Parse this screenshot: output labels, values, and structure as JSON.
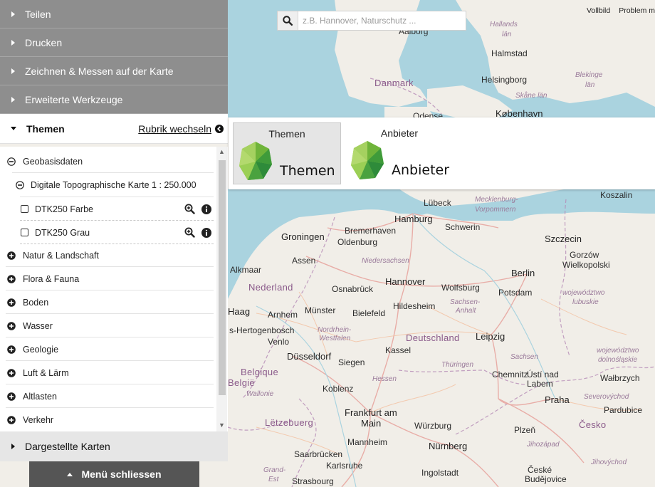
{
  "search": {
    "placeholder": "z.B. Hannover, Naturschutz ..."
  },
  "topbar": {
    "vollbild": "Vollbild",
    "problem": "Problem m"
  },
  "menu": {
    "items": [
      {
        "label": "Teilen"
      },
      {
        "label": "Drucken"
      },
      {
        "label": "Zeichnen & Messen auf der Karte"
      },
      {
        "label": "Erweiterte Werkzeuge"
      }
    ],
    "themen_title": "Themen",
    "rubrik_link": "Rubrik wechseln",
    "dargestellte": "Dargestellte Karten",
    "close_button": "Menü schliessen"
  },
  "tree": {
    "geobasis": "Geobasisdaten",
    "dtk_group": "Digitale Topographische Karte 1 : 250.000",
    "layers": [
      {
        "label": "DTK250 Farbe"
      },
      {
        "label": "DTK250 Grau"
      }
    ],
    "categories": [
      {
        "label": "Natur & Landschaft"
      },
      {
        "label": "Flora & Fauna"
      },
      {
        "label": "Boden"
      },
      {
        "label": "Wasser"
      },
      {
        "label": "Geologie"
      },
      {
        "label": "Luft & Lärm"
      },
      {
        "label": "Altlasten"
      },
      {
        "label": "Verkehr"
      }
    ]
  },
  "rubrik_popup": {
    "cards": [
      {
        "small": "Themen",
        "big": "Themen"
      },
      {
        "small": "Anbieter",
        "big": "Anbieter"
      }
    ]
  },
  "colors": {
    "menu_gray": "#8e8e8e",
    "close_button": "#555555",
    "logo_green_dark": "#2e8b3a",
    "logo_green_light": "#8cc63f",
    "water": "#aad3df",
    "land": "#f0ede6"
  },
  "map_labels": [
    {
      "text": "Aalborg",
      "cls": "city"
    },
    {
      "text": "Hallands",
      "cls": "region"
    },
    {
      "text": "län",
      "cls": "region"
    },
    {
      "text": "Halmstad",
      "cls": "city"
    },
    {
      "text": "Danmark",
      "cls": "country"
    },
    {
      "text": "Helsingborg",
      "cls": "city"
    },
    {
      "text": "Blekinge",
      "cls": "region"
    },
    {
      "text": "län",
      "cls": "region"
    },
    {
      "text": "Skåne län",
      "cls": "region"
    },
    {
      "text": "København",
      "cls": "bigcity"
    },
    {
      "text": "Odense",
      "cls": "city"
    },
    {
      "text": "Koszalin",
      "cls": "city"
    },
    {
      "text": "Lübeck",
      "cls": "city"
    },
    {
      "text": "Mecklenburg-",
      "cls": "region"
    },
    {
      "text": "Vorpommern",
      "cls": "region"
    },
    {
      "text": "Hamburg",
      "cls": "bigcity"
    },
    {
      "text": "Schwerin",
      "cls": "city"
    },
    {
      "text": "Szczecin",
      "cls": "bigcity"
    },
    {
      "text": "Groningen",
      "cls": "bigcity"
    },
    {
      "text": "Bremerhaven",
      "cls": "city"
    },
    {
      "text": "Oldenburg",
      "cls": "city"
    },
    {
      "text": "Gorzów",
      "cls": "city"
    },
    {
      "text": "Wielkopolski",
      "cls": "city"
    },
    {
      "text": "Assen",
      "cls": "city"
    },
    {
      "text": "Niedersachsen",
      "cls": "region"
    },
    {
      "text": "Alkmaar",
      "cls": "city"
    },
    {
      "text": "Berlin",
      "cls": "bigcity"
    },
    {
      "text": "Hannover",
      "cls": "bigcity"
    },
    {
      "text": "Nederland",
      "cls": "country"
    },
    {
      "text": "Osnabrück",
      "cls": "city"
    },
    {
      "text": "Wolfsburg",
      "cls": "city"
    },
    {
      "text": "Potsdam",
      "cls": "city"
    },
    {
      "text": "województwo",
      "cls": "region"
    },
    {
      "text": "lubuskie",
      "cls": "region"
    },
    {
      "text": "Haag",
      "cls": "bigcity"
    },
    {
      "text": "Arnhem",
      "cls": "city"
    },
    {
      "text": "Münster",
      "cls": "city"
    },
    {
      "text": "Bielefeld",
      "cls": "city"
    },
    {
      "text": "Hildesheim",
      "cls": "city"
    },
    {
      "text": "Sachsen-",
      "cls": "region"
    },
    {
      "text": "Anhalt",
      "cls": "region"
    },
    {
      "text": "s-Hertogenbosch",
      "cls": "city"
    },
    {
      "text": "Nordrhein-",
      "cls": "region"
    },
    {
      "text": "Westfalen",
      "cls": "region"
    },
    {
      "text": "Leipzig",
      "cls": "bigcity"
    },
    {
      "text": "Deutschland",
      "cls": "country"
    },
    {
      "text": "Venlo",
      "cls": "city"
    },
    {
      "text": "Kassel",
      "cls": "city"
    },
    {
      "text": "Düsseldorf",
      "cls": "bigcity"
    },
    {
      "text": "województwo",
      "cls": "region"
    },
    {
      "text": "dolnośląskie",
      "cls": "region"
    },
    {
      "text": "Sachsen",
      "cls": "region"
    },
    {
      "text": "Siegen",
      "cls": "city"
    },
    {
      "text": "Thüringen",
      "cls": "region"
    },
    {
      "text": "Belgique",
      "cls": "country"
    },
    {
      "text": "België",
      "cls": "country"
    },
    {
      "text": "Chemnitz",
      "cls": "city"
    },
    {
      "text": "Ústí nad",
      "cls": "city"
    },
    {
      "text": "Labem",
      "cls": "city"
    },
    {
      "text": "Wałbrzych",
      "cls": "city"
    },
    {
      "text": "Hessen",
      "cls": "region"
    },
    {
      "text": "Koblenz",
      "cls": "city"
    },
    {
      "text": "Wallonie",
      "cls": "region"
    },
    {
      "text": "Severovýchod",
      "cls": "region"
    },
    {
      "text": "Praha",
      "cls": "bigcity"
    },
    {
      "text": "Frankfurt am",
      "cls": "bigcity"
    },
    {
      "text": "Main",
      "cls": "bigcity"
    },
    {
      "text": "Pardubice",
      "cls": "city"
    },
    {
      "text": "Lëtzebuerg",
      "cls": "country"
    },
    {
      "text": "Würzburg",
      "cls": "city"
    },
    {
      "text": "Plzeň",
      "cls": "city"
    },
    {
      "text": "Česko",
      "cls": "country"
    },
    {
      "text": "Mannheim",
      "cls": "city"
    },
    {
      "text": "Nürnberg",
      "cls": "bigcity"
    },
    {
      "text": "Jihozápad",
      "cls": "region"
    },
    {
      "text": "Saarbrücken",
      "cls": "city"
    },
    {
      "text": "Karlsruhe",
      "cls": "city"
    },
    {
      "text": "Jihovýchod",
      "cls": "region"
    },
    {
      "text": "Grand-",
      "cls": "region"
    },
    {
      "text": "Est",
      "cls": "region"
    },
    {
      "text": "Ingolstadt",
      "cls": "city"
    },
    {
      "text": "České",
      "cls": "city"
    },
    {
      "text": "Budějovice",
      "cls": "city"
    },
    {
      "text": "Strasbourg",
      "cls": "city"
    }
  ]
}
